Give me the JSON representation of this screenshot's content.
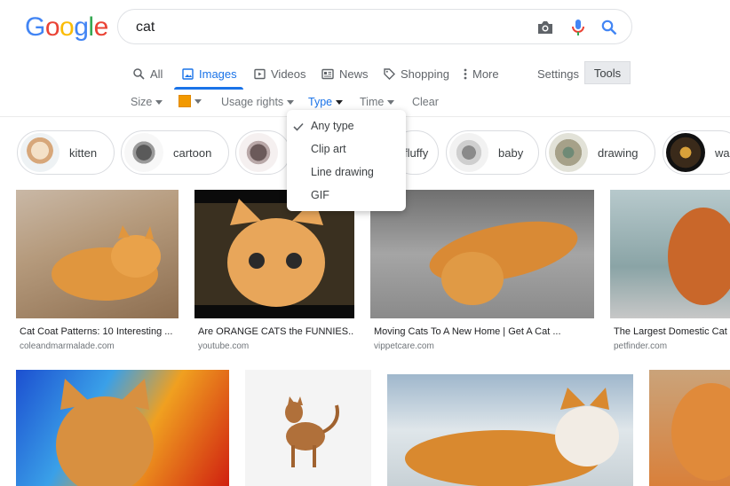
{
  "logo": {
    "letters": [
      "G",
      "o",
      "o",
      "g",
      "l",
      "e"
    ],
    "colors": [
      "#4285f4",
      "#ea4335",
      "#fbbc05",
      "#4285f4",
      "#34a853",
      "#ea4335"
    ]
  },
  "search": {
    "query": "cat"
  },
  "tabs": [
    {
      "label": "All",
      "icon": "search-icon"
    },
    {
      "label": "Images",
      "icon": "image-icon"
    },
    {
      "label": "Videos",
      "icon": "video-icon"
    },
    {
      "label": "News",
      "icon": "news-icon"
    },
    {
      "label": "Shopping",
      "icon": "tag-icon"
    },
    {
      "label": "More",
      "icon": "more-vert-icon"
    }
  ],
  "settings_label": "Settings",
  "tools_label": "Tools",
  "filters": {
    "size": "Size",
    "color_swatch": "#f29900",
    "usage_rights": "Usage rights",
    "type": "Type",
    "time": "Time",
    "clear": "Clear"
  },
  "type_menu": {
    "items": [
      "Any type",
      "Clip art",
      "Line drawing",
      "GIF"
    ],
    "selected": "Any type"
  },
  "chips": [
    "kitten",
    "cartoon",
    "",
    "fluffy",
    "baby",
    "drawing",
    "wa"
  ],
  "results_row1": [
    {
      "caption": "Cat Coat Patterns: 10 Interesting ...",
      "source": "coleandmarmalade.com"
    },
    {
      "caption": "Are ORANGE CATS the FUNNIES...",
      "source": "youtube.com"
    },
    {
      "caption": "Moving Cats To A New Home | Get A Cat ...",
      "source": "vippetcare.com"
    },
    {
      "caption": "The Largest Domestic Cat",
      "source": "petfinder.com"
    }
  ],
  "accent": "#1a73e8"
}
